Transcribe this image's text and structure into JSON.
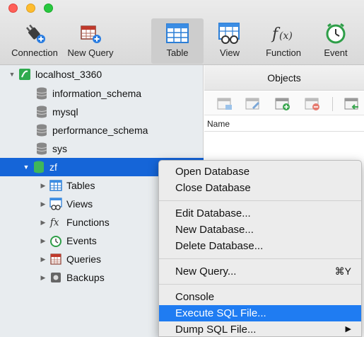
{
  "window_controls": {
    "close_color": "#ff5f57",
    "minimize_color": "#febc2e",
    "zoom_color": "#28c840"
  },
  "toolbar": {
    "connection": "Connection",
    "new_query": "New Query",
    "table": "Table",
    "view": "View",
    "function": "Function",
    "event": "Event"
  },
  "sidebar": {
    "connection_name": "localhost_3360",
    "databases": [
      "information_schema",
      "mysql",
      "performance_schema",
      "sys"
    ],
    "selected_db": "zf",
    "children": [
      "Tables",
      "Views",
      "Functions",
      "Events",
      "Queries",
      "Backups"
    ]
  },
  "objects": {
    "title": "Objects",
    "name_column": "Name"
  },
  "context_menu": {
    "open_db": "Open Database",
    "close_db": "Close Database",
    "edit_db": "Edit Database...",
    "new_db": "New Database...",
    "delete_db": "Delete Database...",
    "new_query": "New Query...",
    "new_query_shortcut": "⌘Y",
    "console": "Console",
    "execute_sql": "Execute SQL File...",
    "dump_sql": "Dump SQL File...",
    "dump_arrow": "▶"
  },
  "colors": {
    "selection": "#1565d8",
    "menu_highlight": "#1f7cf2",
    "sidebar_bg": "#e8ecef"
  }
}
